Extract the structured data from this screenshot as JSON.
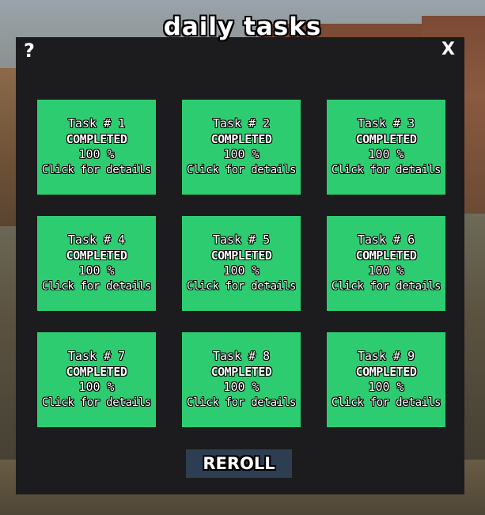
{
  "header": {
    "title": "daily tasks",
    "help_label": "?",
    "close_label": "X"
  },
  "tasks": [
    {
      "name": "Task # 1",
      "status": "COMPLETED",
      "progress": "100 %",
      "details": "Click for details"
    },
    {
      "name": "Task # 2",
      "status": "COMPLETED",
      "progress": "100 %",
      "details": "Click for details"
    },
    {
      "name": "Task # 3",
      "status": "COMPLETED",
      "progress": "100 %",
      "details": "Click for details"
    },
    {
      "name": "Task # 4",
      "status": "COMPLETED",
      "progress": "100 %",
      "details": "Click for details"
    },
    {
      "name": "Task # 5",
      "status": "COMPLETED",
      "progress": "100 %",
      "details": "Click for details"
    },
    {
      "name": "Task # 6",
      "status": "COMPLETED",
      "progress": "100 %",
      "details": "Click for details"
    },
    {
      "name": "Task # 7",
      "status": "COMPLETED",
      "progress": "100 %",
      "details": "Click for details"
    },
    {
      "name": "Task # 8",
      "status": "COMPLETED",
      "progress": "100 %",
      "details": "Click for details"
    },
    {
      "name": "Task # 9",
      "status": "COMPLETED",
      "progress": "100 %",
      "details": "Click for details"
    }
  ],
  "footer": {
    "reroll_label": "REROLL"
  },
  "colors": {
    "panel_bg": "#1c1c1e",
    "card_bg": "#2ecc71",
    "reroll_bg": "#2e3e52",
    "text": "#ffffff"
  }
}
